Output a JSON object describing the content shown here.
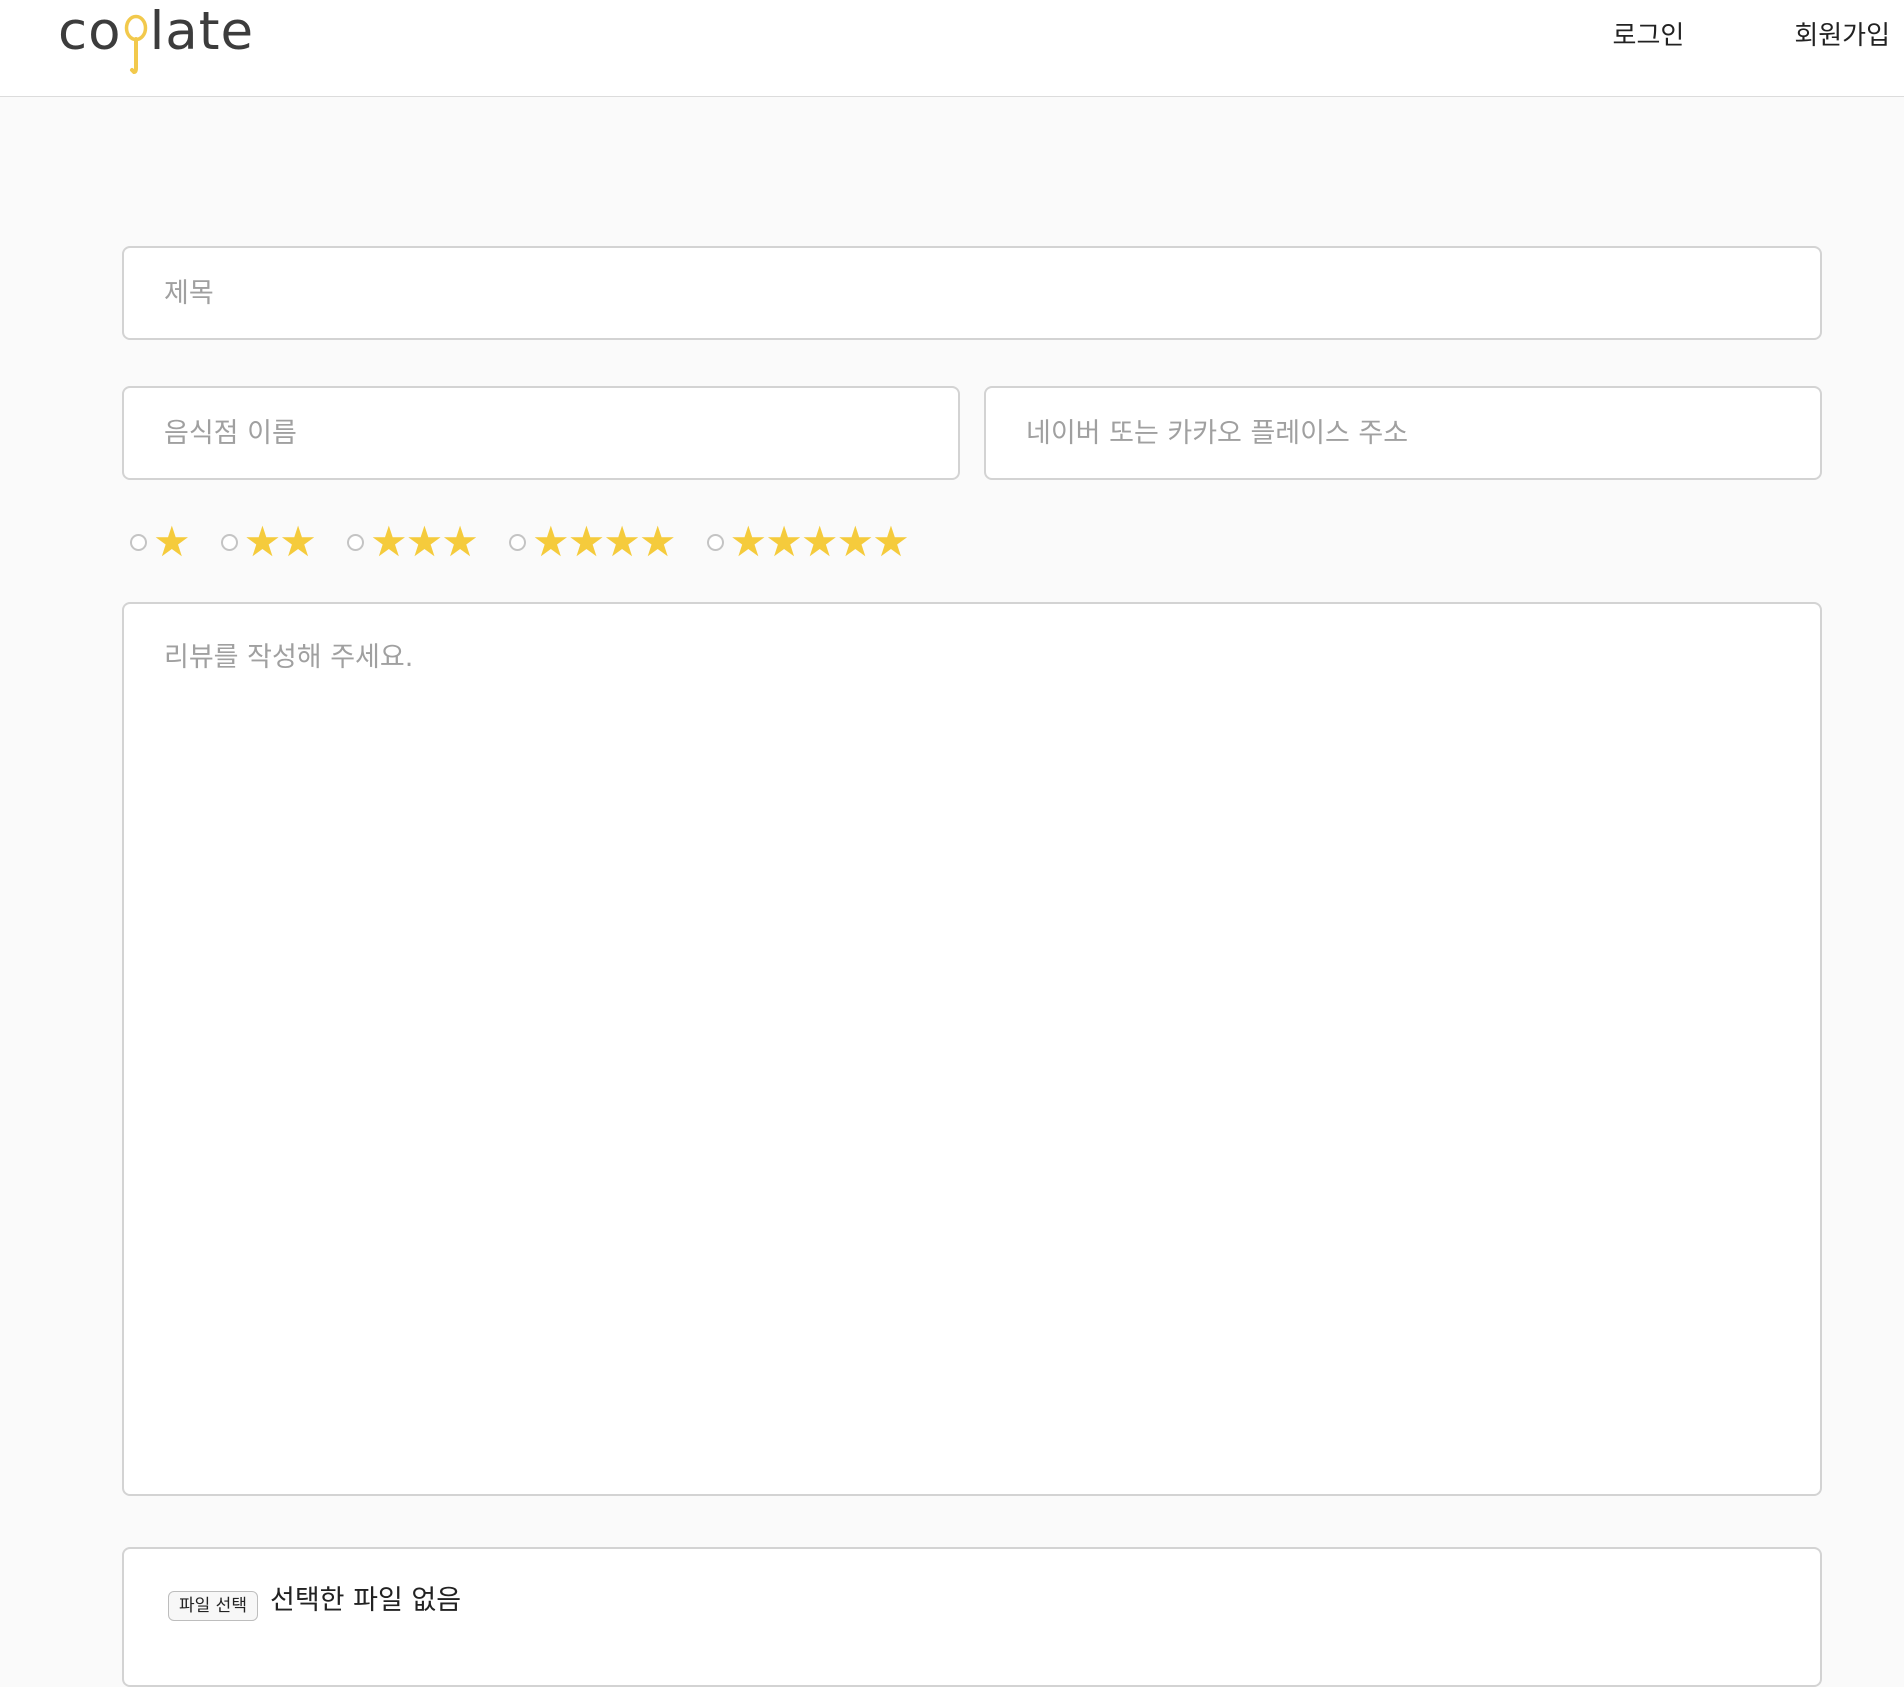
{
  "header": {
    "logo_prefix": "co",
    "logo_suffix": "late",
    "login_label": "로그인",
    "signup_label": "회원가입"
  },
  "form": {
    "title_placeholder": "제목",
    "restaurant_placeholder": "음식점 이름",
    "place_url_placeholder": "네이버 또는 카카오 플레이스 주소",
    "review_placeholder": "리뷰를 작성해 주세요.",
    "ratings": [
      {
        "stars": "★",
        "value": 1,
        "selected": false
      },
      {
        "stars": "★★",
        "value": 2,
        "selected": false
      },
      {
        "stars": "★★★",
        "value": 3,
        "selected": false
      },
      {
        "stars": "★★★★",
        "value": 4,
        "selected": false
      },
      {
        "stars": "★★★★★",
        "value": 5,
        "selected": false
      }
    ],
    "file_button_label": "파일 선택",
    "file_status": "선택한 파일 없음"
  },
  "colors": {
    "star": "#f5cb3c",
    "logo_accent": "#f2c94c",
    "logo_text": "#3c3c3c",
    "background": "#fafafa"
  },
  "icons": {
    "logo": "spoon-icon",
    "rating": "star-icon"
  }
}
